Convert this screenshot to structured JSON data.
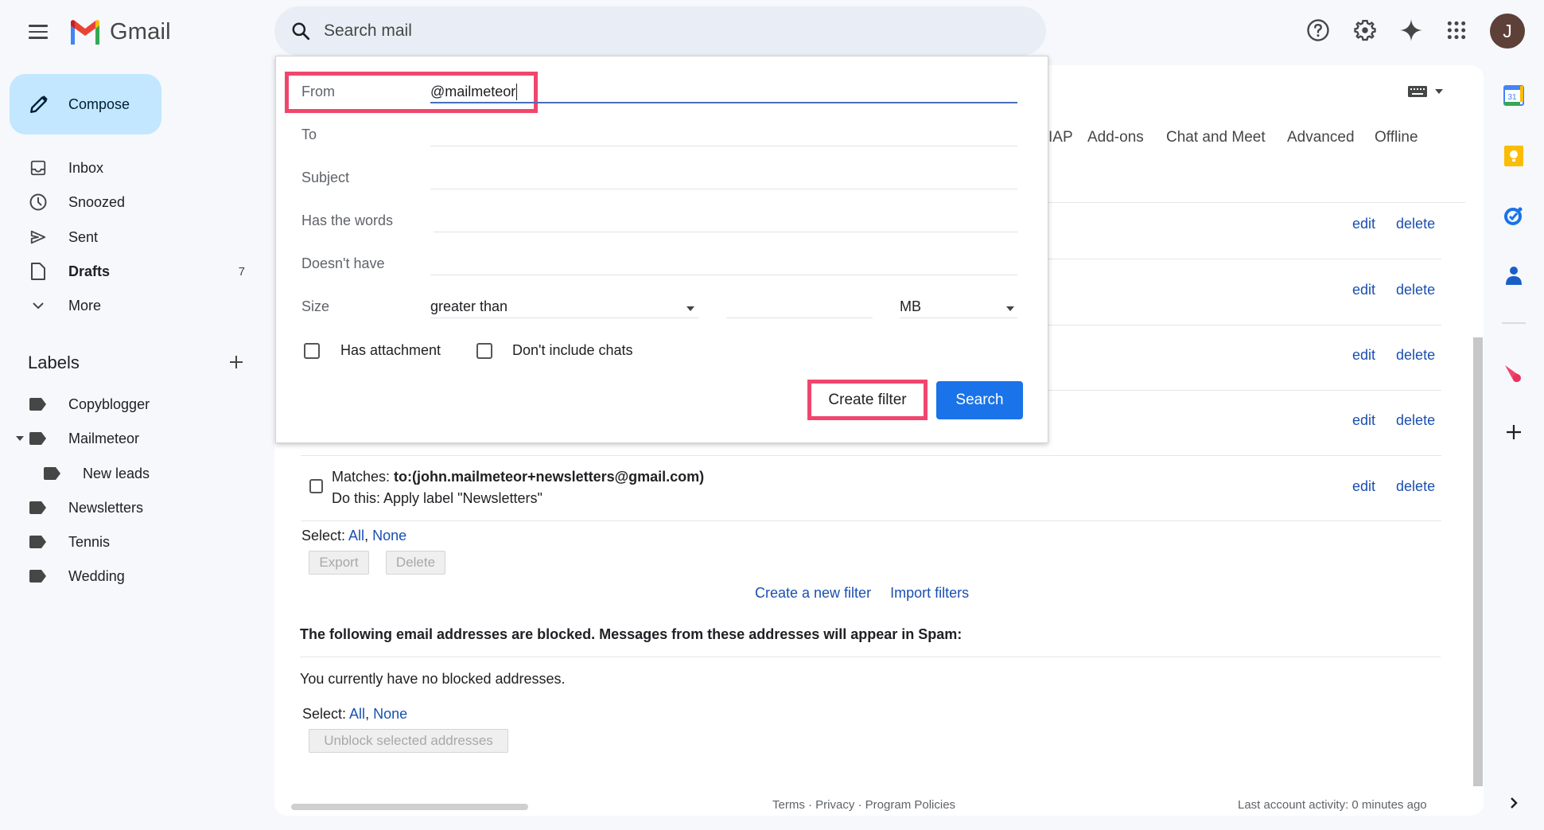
{
  "app": {
    "name": "Gmail"
  },
  "header": {
    "search_placeholder": "Search mail",
    "icons": [
      "help-icon",
      "settings-icon",
      "gemini-sparkle-icon",
      "apps-grid-icon"
    ],
    "avatar_initial": "J",
    "colors": {
      "avatar_bg": "#5d4037",
      "search_bg": "#e9eef6"
    }
  },
  "sidebar": {
    "compose_label": "Compose",
    "nav": [
      {
        "label": "Inbox",
        "icon": "inbox-icon"
      },
      {
        "label": "Snoozed",
        "icon": "clock-icon"
      },
      {
        "label": "Sent",
        "icon": "send-icon"
      },
      {
        "label": "Drafts",
        "icon": "draft-icon",
        "count": "7"
      },
      {
        "label": "More",
        "icon": "chevron-down-icon"
      }
    ],
    "labels_heading": "Labels",
    "labels": [
      {
        "label": "Copyblogger"
      },
      {
        "label": "Mailmeteor",
        "expanded": true
      },
      {
        "label": "New leads",
        "nested": true
      },
      {
        "label": "Newsletters"
      },
      {
        "label": "Tennis"
      },
      {
        "label": "Wedding"
      }
    ]
  },
  "settings": {
    "tabs": [
      "IAP",
      "Add-ons",
      "Chat and Meet",
      "Advanced",
      "Offline"
    ],
    "filter_rows": [
      {
        "edit": "edit",
        "delete": "delete"
      },
      {
        "edit": "edit",
        "delete": "delete"
      },
      {
        "edit": "edit",
        "delete": "delete"
      },
      {
        "edit": "edit",
        "delete": "delete"
      },
      {
        "matches_label": "Matches:",
        "matches_value": "to:(john.mailmeteor+newsletters@gmail.com)",
        "action": "Do this: Apply label \"Newsletters\"",
        "edit": "edit",
        "delete": "delete"
      }
    ],
    "select_label": "Select:",
    "select_all": "All",
    "select_none": "None",
    "export_label": "Export",
    "delete_label": "Delete",
    "create_new_filter": "Create a new filter",
    "import_filters": "Import filters",
    "blocked_heading": "The following email addresses are blocked. Messages from these addresses will appear in Spam:",
    "blocked_empty": "You currently have no blocked addresses.",
    "unblock_label": "Unblock selected addresses",
    "sep_comma": ","
  },
  "footer": {
    "links": "Terms · Privacy · Program Policies",
    "activity": "Last account activity: 0 minutes ago"
  },
  "filter_popup": {
    "from_label": "From",
    "from_value": "@mailmeteor",
    "to_label": "To",
    "subject_label": "Subject",
    "has_words_label": "Has the words",
    "doesnt_have_label": "Doesn't have",
    "size_label": "Size",
    "size_operator": "greater than",
    "size_value": "",
    "size_unit": "MB",
    "has_attachment_label": "Has attachment",
    "dont_include_chats_label": "Don't include chats",
    "create_filter_label": "Create filter",
    "search_label": "Search",
    "colors": {
      "highlight": "#f0466e",
      "primary": "#1a73e8"
    }
  },
  "right_rail": [
    "calendar-icon",
    "keep-icon",
    "tasks-icon",
    "contacts-icon",
    "mailmeteor-icon",
    "add-icon"
  ]
}
